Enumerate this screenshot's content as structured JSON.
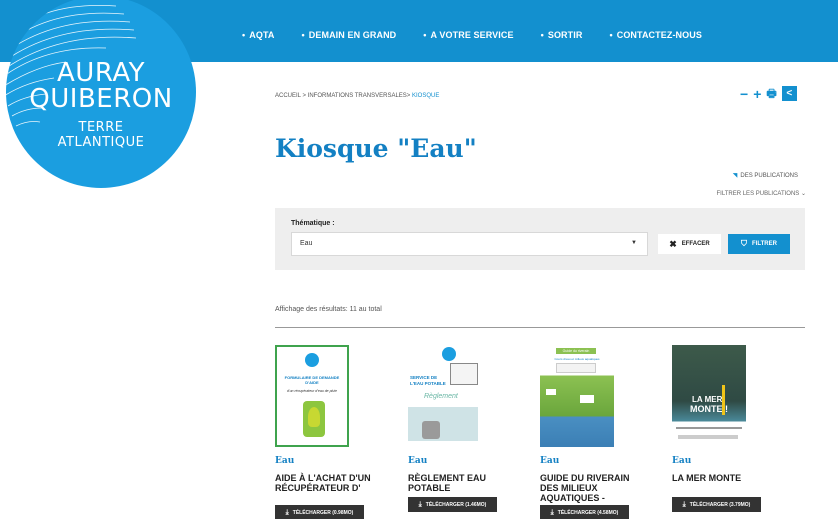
{
  "header": {
    "logo": {
      "line1": "AURAY",
      "line2": "QUIBERON",
      "line3": "TERRE",
      "line4": "ATLANTIQUE"
    },
    "nav": [
      {
        "label": "AQTA"
      },
      {
        "label": "DEMAIN EN GRAND"
      },
      {
        "label": "A VOTRE SERVICE"
      },
      {
        "label": "SORTIR"
      },
      {
        "label": "CONTACTEZ-NOUS"
      }
    ],
    "nav_bullet": "•"
  },
  "breadcrumb": {
    "home": "ACCUEIL",
    "sep": ">",
    "section": "INFORMATIONS TRANSVERSALES",
    "current": "KIOSQUE"
  },
  "tools": {
    "decrease": "−",
    "increase": "+",
    "print": "🖶",
    "share": "<"
  },
  "page": {
    "title": "Kiosque \"Eau\"",
    "pubs_link": "DES PUBLICATIONS",
    "filter_link": "FILTRER LES PUBLICATIONS"
  },
  "filter": {
    "label": "Thématique :",
    "selected": "Eau",
    "clear_label": "EFFACER",
    "filter_label": "FILTRER"
  },
  "results_text": "Affichage des résultats: 11 au total",
  "cards": [
    {
      "category": "Eau",
      "title": "AIDE À L'ACHAT D'UN RÉCUPÉRATEUR D'",
      "download": "TÉLÉCHARGER (0.98MO)",
      "cover_text1": "FORMULAIRE DE DEMANDE D'AIDE",
      "cover_text2": "d'un récupérateur d'eau de pluie"
    },
    {
      "category": "Eau",
      "title": "RÈGLEMENT EAU POTABLE",
      "download": "TÉLÉCHARGER (1.46MO)",
      "cover_text1": "SERVICE DE L'EAU POTABLE",
      "cover_text2": "Règlement"
    },
    {
      "category": "Eau",
      "title": "GUIDE DU RIVERAIN DES MILIEUX AQUATIQUES -",
      "download": "TÉLÉCHARGER (4.58MO)",
      "cover_text1": "Guide du riverain",
      "cover_text2": "Cours d'eau et milieux aquatiques"
    },
    {
      "category": "Eau",
      "title": "LA MER MONTE",
      "download": "TÉLÉCHARGER (3.79MO)",
      "cover_text1": "LA MER",
      "cover_text2": "MONTE !"
    }
  ],
  "colors": {
    "primary": "#1390cf",
    "title": "#1380c3",
    "dark_button": "#333333",
    "panel": "#eeeeee"
  },
  "icons": {
    "rss": "rss-icon",
    "clear": "close-icon",
    "filter": "filter-icon",
    "download": "download-icon",
    "caret": "chevron-down-icon"
  }
}
